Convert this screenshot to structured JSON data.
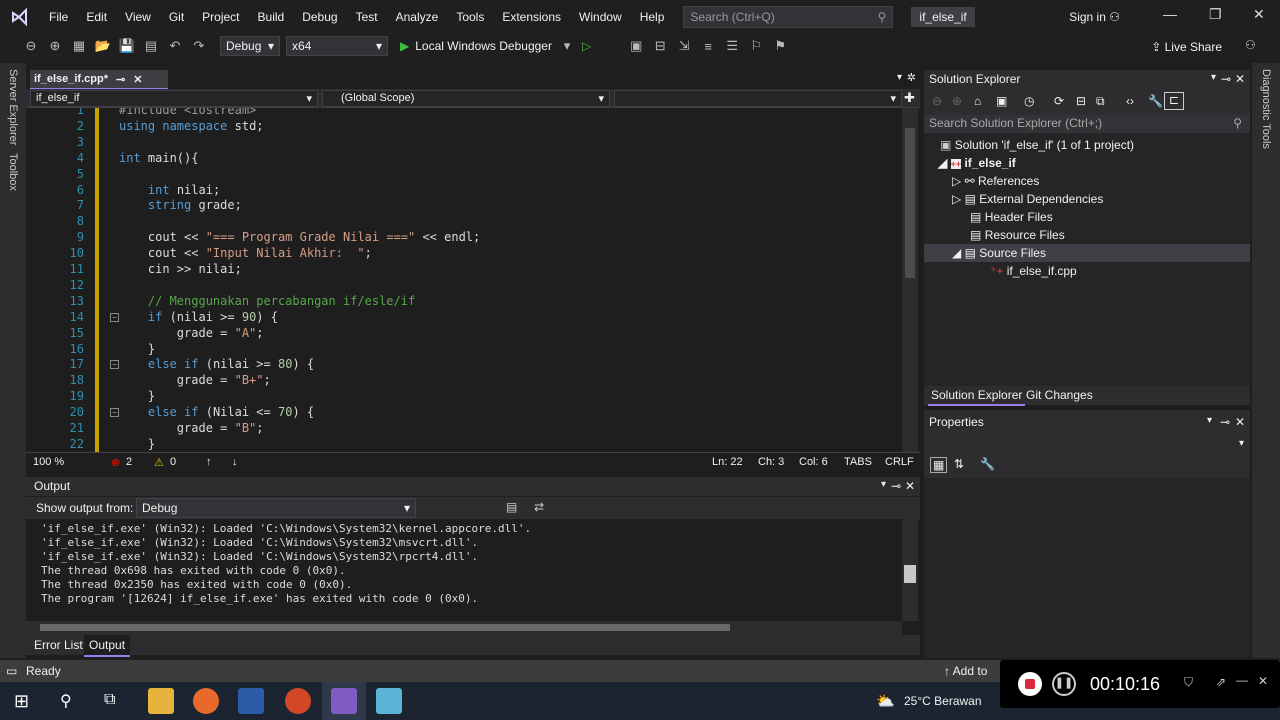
{
  "menubar": {
    "items": [
      "File",
      "Edit",
      "View",
      "Git",
      "Project",
      "Build",
      "Debug",
      "Test",
      "Analyze",
      "Tools",
      "Extensions",
      "Window",
      "Help"
    ],
    "search_placeholder": "Search (Ctrl+Q)",
    "solution_badge": "if_else_if",
    "sign_in": "Sign in"
  },
  "toolbar": {
    "config": "Debug",
    "platform": "x64",
    "run_label": "Local Windows Debugger",
    "live_share": "Live Share"
  },
  "side_tabs": {
    "left": [
      "Server Explorer",
      "Toolbox"
    ],
    "right": "Diagnostic Tools"
  },
  "editor": {
    "tab_label": "if_else_if.cpp*",
    "nav_project": "if_else_if",
    "nav_scope": "(Global Scope)",
    "lines": [
      {
        "n": "1",
        "text": "#include <iostream>"
      },
      {
        "n": "2",
        "text": "using namespace std;"
      },
      {
        "n": "3",
        "text": ""
      },
      {
        "n": "4",
        "text": "int main(){"
      },
      {
        "n": "5",
        "text": ""
      },
      {
        "n": "6",
        "text": "    int nilai;"
      },
      {
        "n": "7",
        "text": "    string grade;"
      },
      {
        "n": "8",
        "text": ""
      },
      {
        "n": "9",
        "text": "    cout << \"=== Program Grade Nilai ===\" << endl;"
      },
      {
        "n": "10",
        "text": "    cout << \"Input Nilai Akhir:  \";"
      },
      {
        "n": "11",
        "text": "    cin >> nilai;"
      },
      {
        "n": "12",
        "text": ""
      },
      {
        "n": "13",
        "text": "    // Menggunakan percabangan if/esle/if"
      },
      {
        "n": "14",
        "text": "    if (nilai >= 90) {"
      },
      {
        "n": "15",
        "text": "        grade = \"A\";"
      },
      {
        "n": "16",
        "text": "    }"
      },
      {
        "n": "17",
        "text": "    else if (nilai >= 80) {"
      },
      {
        "n": "18",
        "text": "        grade = \"B+\";"
      },
      {
        "n": "19",
        "text": "    }"
      },
      {
        "n": "20",
        "text": "    else if (Nilai <= 70) {"
      },
      {
        "n": "21",
        "text": "        grade = \"B\";"
      },
      {
        "n": "22",
        "text": "    }"
      }
    ],
    "status": {
      "zoom": "100 %",
      "errors": "2",
      "warnings": "0",
      "ln": "Ln: 22",
      "ch": "Ch: 3",
      "col": "Col: 6",
      "tabs": "TABS",
      "eol": "CRLF"
    }
  },
  "output": {
    "title": "Output",
    "show_from_label": "Show output from:",
    "source": "Debug",
    "lines": [
      "'if_else_if.exe' (Win32): Loaded 'C:\\Windows\\System32\\kernel.appcore.dll'.",
      "'if_else_if.exe' (Win32): Loaded 'C:\\Windows\\System32\\msvcrt.dll'.",
      "'if_else_if.exe' (Win32): Loaded 'C:\\Windows\\System32\\rpcrt4.dll'.",
      "The thread 0x698 has exited with code 0 (0x0).",
      "The thread 0x2350 has exited with code 0 (0x0).",
      "The program '[12624] if_else_if.exe' has exited with code 0 (0x0)."
    ],
    "tabs": [
      "Error List",
      "Output"
    ]
  },
  "solution_explorer": {
    "title": "Solution Explorer",
    "search_placeholder": "Search Solution Explorer (Ctrl+;)",
    "solution": "Solution 'if_else_if' (1 of 1 project)",
    "project": "if_else_if",
    "nodes": [
      "References",
      "External Dependencies",
      "Header Files",
      "Resource Files",
      "Source Files"
    ],
    "file": "if_else_if.cpp",
    "tabs": [
      "Solution Explorer",
      "Git Changes"
    ]
  },
  "properties": {
    "title": "Properties"
  },
  "statusbar": {
    "ready": "Ready",
    "add_to": "Add to"
  },
  "taskbar": {
    "weather": "25°C  Berawan"
  },
  "recorder": {
    "time": "00:10:16"
  }
}
